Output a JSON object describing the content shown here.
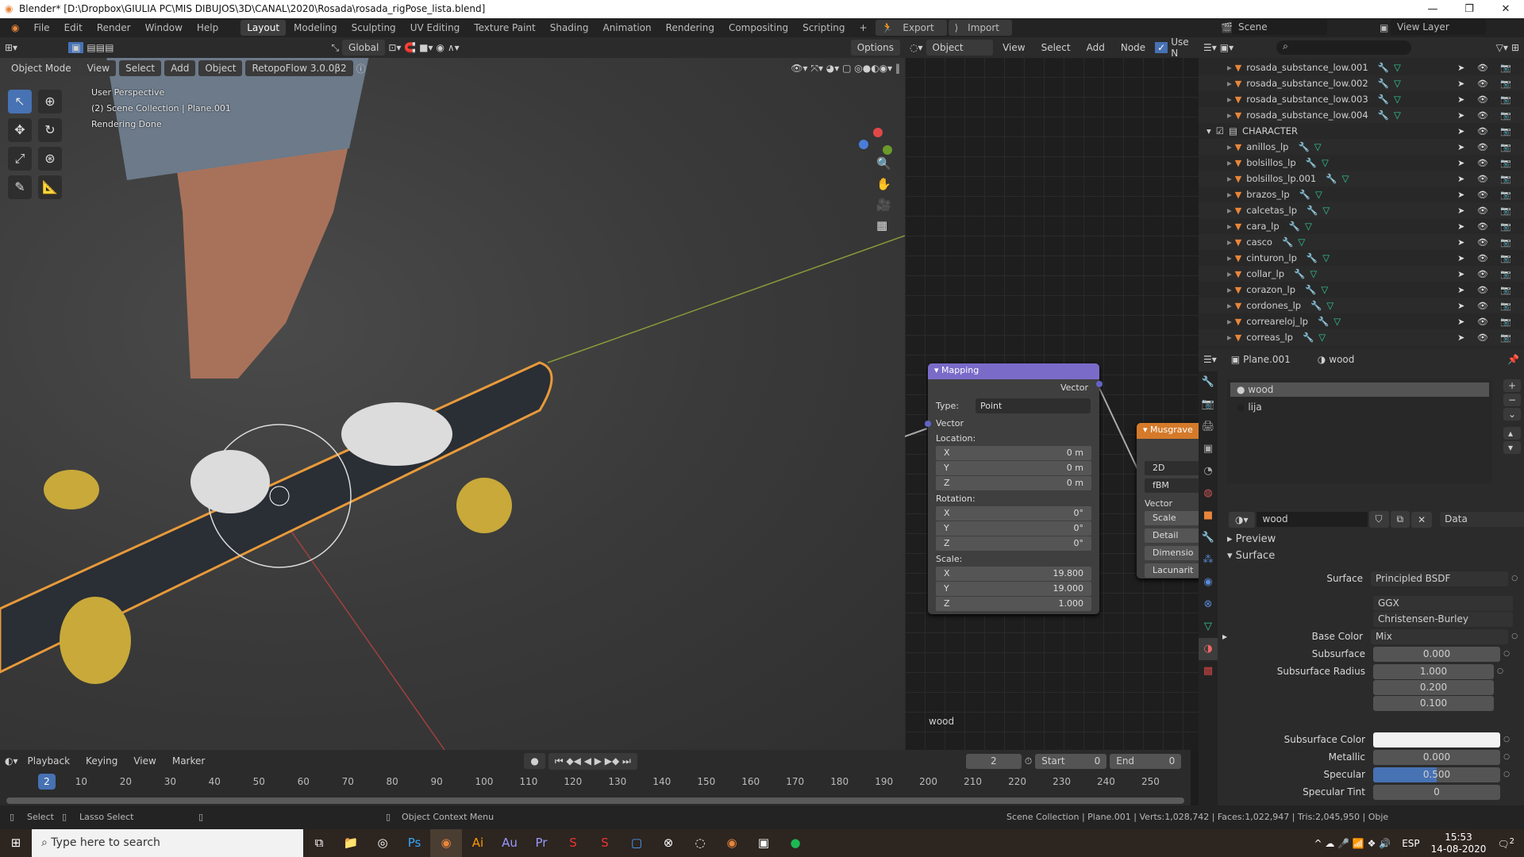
{
  "window": {
    "title": "Blender* [D:\\Dropbox\\GIULIA PC\\MIS DIBUJOS\\3D\\CANAL\\2020\\Rosada\\rosada_rigPose_lista.blend]"
  },
  "menu": [
    "File",
    "Edit",
    "Render",
    "Window",
    "Help"
  ],
  "workspaces": [
    "Layout",
    "Modeling",
    "Sculpting",
    "UV Editing",
    "Texture Paint",
    "Shading",
    "Animation",
    "Rendering",
    "Compositing",
    "Scripting"
  ],
  "workspace_active": "Layout",
  "export_label": "Export",
  "import_label": "Import",
  "scene": "Scene",
  "view_layer": "View Layer",
  "viewport": {
    "transform": "Global",
    "options": "Options",
    "mode": "Object Mode",
    "menus": [
      "View",
      "Select",
      "Add",
      "Object"
    ],
    "addon": "RetopoFlow 3.0.0β2",
    "overlay": [
      "User Perspective",
      "(2) Scene Collection | Plane.001",
      "Rendering Done"
    ]
  },
  "node_editor": {
    "type": "Object",
    "menus": [
      "View",
      "Select",
      "Add",
      "Node"
    ],
    "use_nodes": "Use N",
    "footer_label": "wood",
    "mapping": {
      "title": "Mapping",
      "out": "Vector",
      "type_label": "Type:",
      "type": "Point",
      "in": "Vector",
      "groups": [
        {
          "label": "Location:",
          "rows": [
            [
              "X",
              "0 m"
            ],
            [
              "Y",
              "0 m"
            ],
            [
              "Z",
              "0 m"
            ]
          ]
        },
        {
          "label": "Rotation:",
          "rows": [
            [
              "X",
              "0°"
            ],
            [
              "Y",
              "0°"
            ],
            [
              "Z",
              "0°"
            ]
          ]
        },
        {
          "label": "Scale:",
          "rows": [
            [
              "X",
              "19.800"
            ],
            [
              "Y",
              "19.000"
            ],
            [
              "Z",
              "1.000"
            ]
          ]
        }
      ]
    },
    "musgrave": {
      "title": "Musgrave",
      "dim": "2D",
      "type": "fBM",
      "in": "Vector",
      "inputs": [
        "Scale",
        "Detail",
        "Dimensio",
        "Lacunarit"
      ]
    }
  },
  "outliner": {
    "items": [
      {
        "name": "rosada_substance_low.001",
        "level": 1
      },
      {
        "name": "rosada_substance_low.002",
        "level": 1
      },
      {
        "name": "rosada_substance_low.003",
        "level": 1
      },
      {
        "name": "rosada_substance_low.004",
        "level": 1
      },
      {
        "name": "CHARACTER",
        "level": 0,
        "collection": true
      },
      {
        "name": "anillos_lp",
        "level": 1
      },
      {
        "name": "bolsillos_lp",
        "level": 1
      },
      {
        "name": "bolsillos_lp.001",
        "level": 1
      },
      {
        "name": "brazos_lp",
        "level": 1
      },
      {
        "name": "calcetas_lp",
        "level": 1
      },
      {
        "name": "cara_lp",
        "level": 1
      },
      {
        "name": "casco",
        "level": 1
      },
      {
        "name": "cinturon_lp",
        "level": 1
      },
      {
        "name": "collar_lp",
        "level": 1
      },
      {
        "name": "corazon_lp",
        "level": 1
      },
      {
        "name": "cordones_lp",
        "level": 1
      },
      {
        "name": "correareloj_lp",
        "level": 1
      },
      {
        "name": "correas_lp",
        "level": 1
      }
    ]
  },
  "properties": {
    "object": "Plane.001",
    "material": "wood",
    "slots": [
      "wood",
      "lija"
    ],
    "mat_name": "wood",
    "link": "Data",
    "preview": "Preview",
    "surface_panel": "Surface",
    "surface_label": "Surface",
    "surface": "Principled BSDF",
    "distribution": "GGX",
    "sss_method": "Christensen-Burley",
    "base_color_label": "Base Color",
    "base_color": "Mix",
    "subsurface_label": "Subsurface",
    "subsurface": "0.000",
    "radius_label": "Subsurface Radius",
    "radius": [
      "1.000",
      "0.200",
      "0.100"
    ],
    "sss_color_label": "Subsurface Color",
    "metallic_label": "Metallic",
    "metallic": "0.000",
    "specular_label": "Specular",
    "specular": "0.500",
    "specular_fraction": 0.5,
    "spec_tint_label": "Specular Tint",
    "spec_tint": "0"
  },
  "timeline": {
    "menus": [
      "Playback",
      "Keying",
      "View",
      "Marker"
    ],
    "current": "2",
    "start_label": "Start",
    "start": "0",
    "end_label": "End",
    "end": "0",
    "ticks": [
      "10",
      "20",
      "30",
      "40",
      "50",
      "60",
      "70",
      "80",
      "90",
      "100",
      "110",
      "120",
      "130",
      "140",
      "150",
      "160",
      "170",
      "180",
      "190",
      "200",
      "210",
      "220",
      "230",
      "240",
      "250"
    ]
  },
  "status": {
    "select": "Select",
    "lasso": "Lasso Select",
    "context": "Object Context Menu",
    "stats": "Scene Collection | Plane.001 | Verts:1,028,742 | Faces:1,022,947 | Tris:2,045,950 | Obje"
  },
  "taskbar": {
    "search": "Type here to search",
    "lang": "ESP",
    "time": "15:53",
    "date": "14-08-2020",
    "notif": "2"
  },
  "colors": {
    "accent": "#4772b3",
    "mapping_header": "#7a6bc9",
    "musgrave_header": "#d47a2a",
    "object_icon": "#e8863a"
  }
}
